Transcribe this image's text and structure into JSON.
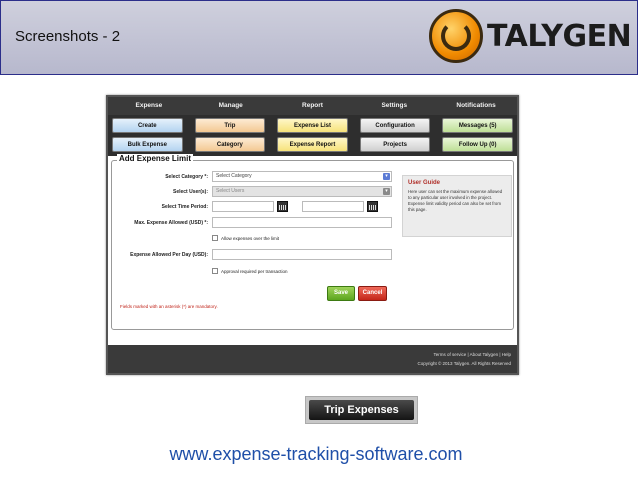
{
  "header": {
    "title": "Screenshots - 2",
    "logo_text": "TALYGEN"
  },
  "app": {
    "menu": [
      "Expense",
      "Manage",
      "Report",
      "Settings",
      "Notifications"
    ],
    "buttons_row1": [
      {
        "label": "Create",
        "color": "blue"
      },
      {
        "label": "Trip",
        "color": "orange"
      },
      {
        "label": "Expense List",
        "color": "yellow"
      },
      {
        "label": "Configuration",
        "color": "grey"
      },
      {
        "label": "Messages (5)",
        "color": "green"
      }
    ],
    "buttons_row2": [
      {
        "label": "Bulk Expense",
        "color": "blue"
      },
      {
        "label": "Category",
        "color": "orange"
      },
      {
        "label": "Expense Report",
        "color": "yellow"
      },
      {
        "label": "Projects",
        "color": "grey"
      },
      {
        "label": "Follow Up (0)",
        "color": "green"
      }
    ],
    "form": {
      "title": "Add Expense Limit",
      "category_label": "Select Category *:",
      "category_value": "Select Category",
      "users_label": "Select User(s):",
      "users_value": "Select Users",
      "time_period_label": "Select Time Period:",
      "max_expense_label": "Max. Expense Allowed (USD) *:",
      "allow_over_limit_label": "Allow expenses over the limit",
      "per_day_label": "Expense Allowed Per Day (USD):",
      "approval_label": "Approval required per transaction",
      "save_label": "Save",
      "cancel_label": "Cancel",
      "mandatory_note": "Fields marked with an asterisk (*) are mandatory."
    },
    "guide": {
      "title": "User Guide",
      "text": "Here user can set the maximum expense allowed to any particular user involved in the project. Expense limit validity period can also be set from this page."
    },
    "footer": {
      "links": "Terms of service | About Talygen | Help",
      "copyright": "Copyright © 2013 Talygen. All Rights Reserved"
    }
  },
  "badge_label": "Trip Expenses",
  "website": "www.expense-tracking-software.com",
  "colors": {
    "header_border": "#2b2e8a",
    "website_text": "#1f4fa8",
    "save_green": "#5ca51f",
    "cancel_red": "#c4261a"
  }
}
